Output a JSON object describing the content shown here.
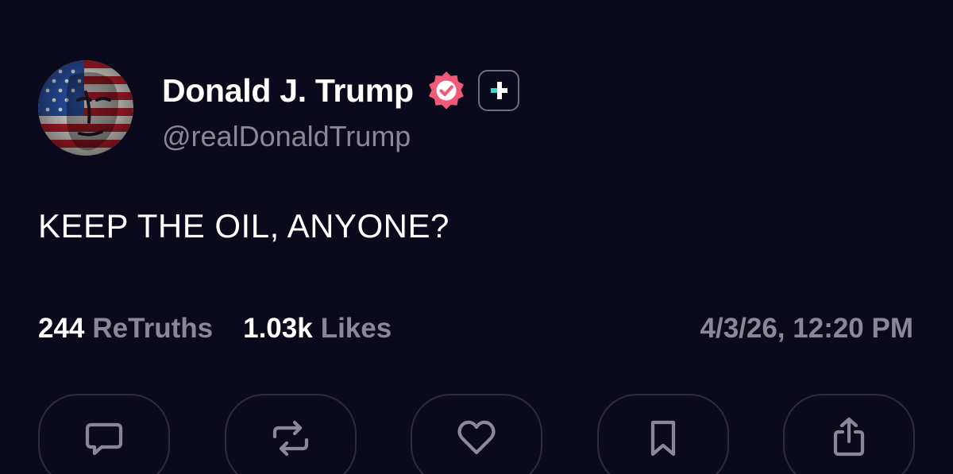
{
  "post": {
    "author": {
      "display_name": "Donald J. Trump",
      "handle": "@realDonaldTrump",
      "avatar_icon": "flag-portrait-avatar",
      "verified_icon": "verified-badge-icon",
      "plus_icon": "plus-badge-icon",
      "verified_color": "#f05a77"
    },
    "text": "KEEP THE OIL, ANYONE?",
    "stats": {
      "retruths_count": "244",
      "retruths_label": "ReTruths",
      "likes_count": "1.03k",
      "likes_label": "Likes"
    },
    "timestamp": "4/3/26, 12:20 PM"
  },
  "actions": [
    {
      "name": "reply",
      "icon": "comment-icon"
    },
    {
      "name": "retruth",
      "icon": "repost-icon"
    },
    {
      "name": "like",
      "icon": "heart-icon"
    },
    {
      "name": "bookmark",
      "icon": "bookmark-icon"
    },
    {
      "name": "share",
      "icon": "share-icon"
    }
  ],
  "colors": {
    "background": "#0b0a1c",
    "primary_text": "#ffffff",
    "secondary_text": "#8a8898",
    "button_border": "#2c2a40",
    "plus_accent": "#3fd7c8"
  }
}
